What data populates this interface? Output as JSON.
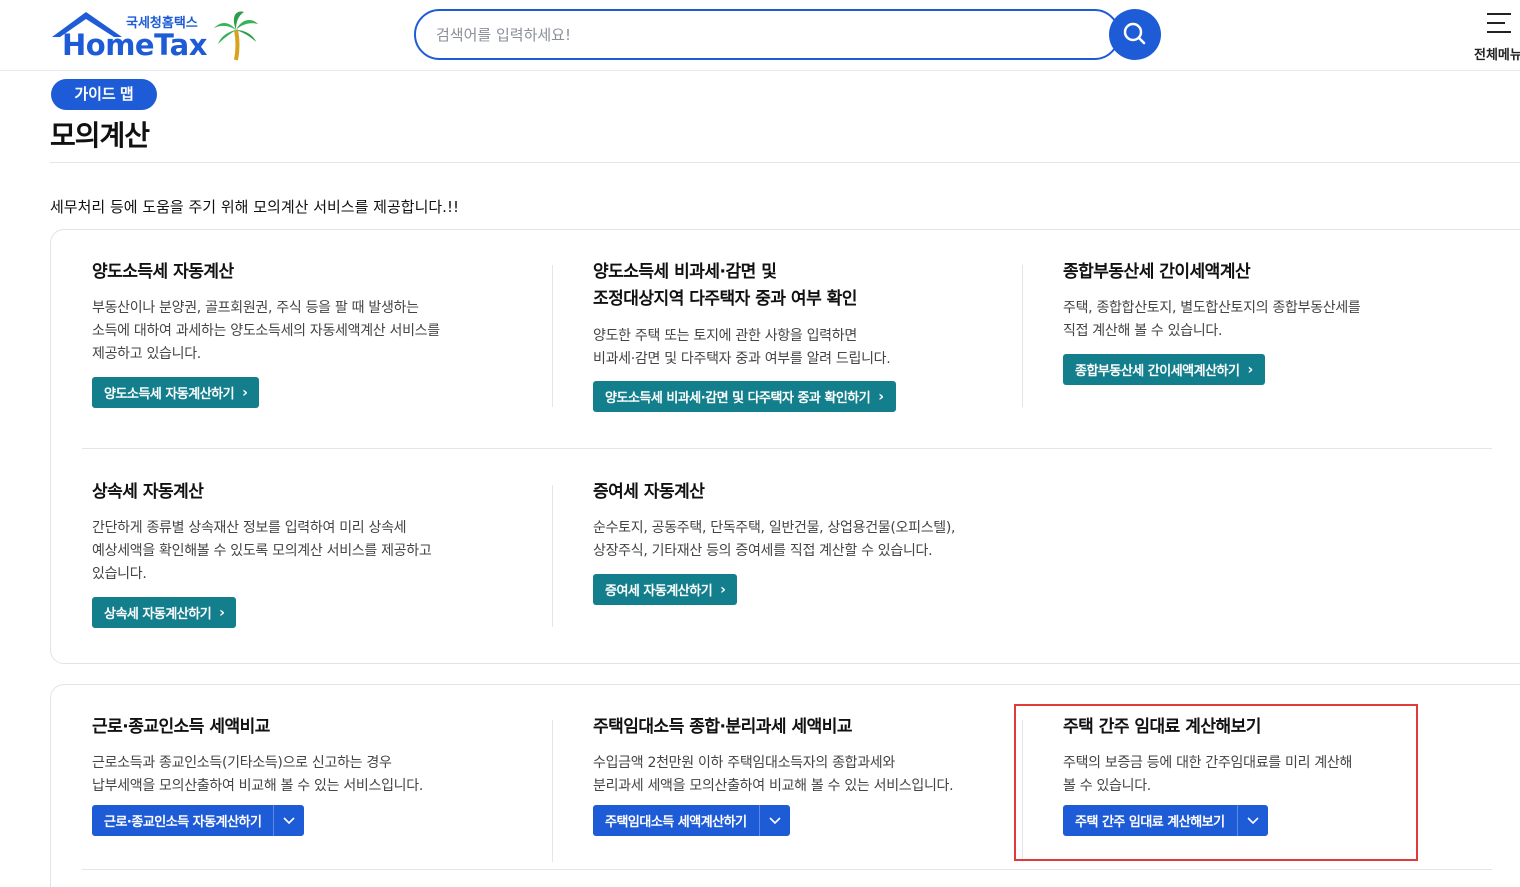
{
  "header": {
    "logo_small": "국세청홈택스",
    "logo_main": "HomeTax",
    "search_placeholder": "검색어를 입력하세요!",
    "menu_label": "전체메뉴"
  },
  "page": {
    "badge": "가이드 맵",
    "title": "모의계산",
    "intro": "세무처리 등에 도움을 주기 위해 모의계산 서비스를 제공합니다.!!"
  },
  "cards": [
    {
      "title_lines": [
        "양도소득세 자동계산"
      ],
      "desc_lines": [
        "부동산이나 분양권, 골프회원권, 주식 등을 팔 때 발생하는",
        "소득에 대하여 과세하는 양도소득세의 자동세액계산 서비스를",
        "제공하고 있습니다."
      ],
      "button": "양도소득세 자동계산하기"
    },
    {
      "title_lines": [
        "양도소득세 비과세·감면 및",
        "조정대상지역 다주택자 중과 여부 확인"
      ],
      "desc_lines": [
        "양도한 주택 또는 토지에 관한 사항을 입력하면",
        "비과세·감면 및 다주택자 중과 여부를 알려 드립니다."
      ],
      "button": "양도소득세 비과세·감면 및 다주택자 중과 확인하기"
    },
    {
      "title_lines": [
        "종합부동산세 간이세액계산"
      ],
      "desc_lines": [
        "주택, 종합합산토지, 별도합산토지의 종합부동산세를",
        "직접 계산해 볼 수 있습니다."
      ],
      "button": "종합부동산세 간이세액계산하기"
    },
    {
      "title_lines": [
        "상속세 자동계산"
      ],
      "desc_lines": [
        "간단하게 종류별 상속재산 정보를 입력하여 미리 상속세",
        "예상세액을 확인해볼 수 있도록 모의계산 서비스를 제공하고",
        "있습니다."
      ],
      "button": "상속세 자동계산하기"
    },
    {
      "title_lines": [
        "증여세 자동계산"
      ],
      "desc_lines": [
        "순수토지, 공동주택, 단독주택, 일반건물, 상업용건물(오피스텔),",
        "상장주식, 기타재산 등의 증여세를 직접 계산할 수 있습니다."
      ],
      "button": "증여세 자동계산하기"
    },
    {
      "title_lines": [
        "근로·종교인소득 세액비교"
      ],
      "desc_lines": [
        "근로소득과 종교인소득(기타소득)으로 신고하는 경우",
        "납부세액을 모의산출하여 비교해 볼 수 있는 서비스입니다."
      ],
      "button": "근로·종교인소득 자동계산하기"
    },
    {
      "title_lines": [
        "주택임대소득 종합·분리과세 세액비교"
      ],
      "desc_lines": [
        "수입금액 2천만원 이하 주택임대소득자의 종합과세와",
        "분리과세 세액을 모의산출하여 비교해 볼 수 있는 서비스입니다."
      ],
      "button": "주택임대소득 세액계산하기"
    },
    {
      "title_lines": [
        "주택 간주 임대료 계산해보기"
      ],
      "desc_lines": [
        "주택의 보증금 등에 대한 간주임대료를 미리 계산해",
        "볼 수 있습니다."
      ],
      "button": "주택 간주 임대료 계산해보기"
    }
  ],
  "colors": {
    "primary_blue": "#1e5bd6",
    "teal": "#137f8c",
    "highlight_red": "#e03b3b"
  },
  "icons": {
    "search": "search-icon",
    "menu": "hamburger-menu-icon",
    "dropdown": "chevron-down-icon",
    "arrow": "chevron-right-icon"
  }
}
